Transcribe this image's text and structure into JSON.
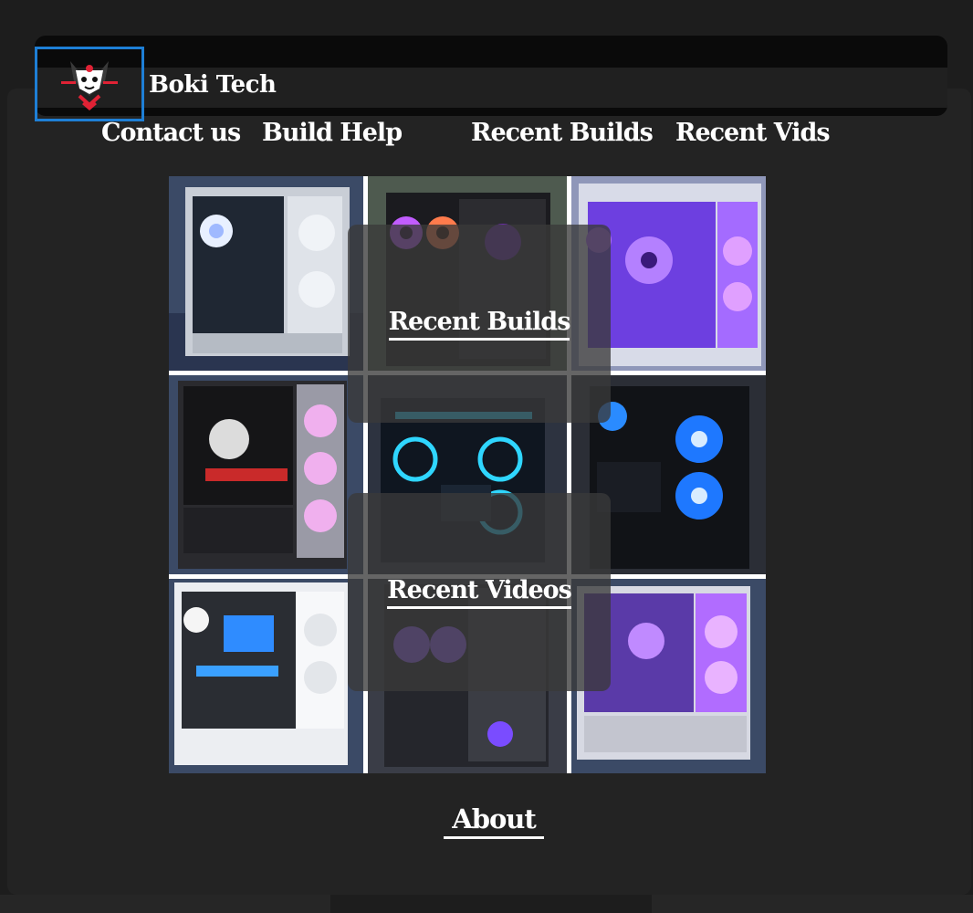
{
  "brand": {
    "title": "Boki Tech",
    "logo_icon": "samurai-cat-logo",
    "accent": "#1e7fd6"
  },
  "nav": {
    "contact": "Contact us",
    "build_help": "Build Help",
    "recent_builds": "Recent Builds",
    "recent_vids": "Recent Vids"
  },
  "gallery": {
    "tiles": [
      {
        "name": "white-fractal-build",
        "glow": "#cfe0ff"
      },
      {
        "name": "dark-mesh-rgb-build",
        "glow": "#c15cff"
      },
      {
        "name": "purple-fan-build",
        "glow": "#9a4cff"
      },
      {
        "name": "montech-pink-build",
        "glow": "#ff9ee8"
      },
      {
        "name": "cyan-ring-build",
        "glow": "#2fd6ff"
      },
      {
        "name": "blue-fan-build",
        "glow": "#2a8bff"
      },
      {
        "name": "white-blue-build",
        "glow": "#3aa0ff"
      },
      {
        "name": "mesh-purple-build",
        "glow": "#9b63ff"
      },
      {
        "name": "white-purple-build",
        "glow": "#b16cff"
      }
    ]
  },
  "overlays": {
    "recent_builds": "Recent Builds",
    "recent_videos": "Recent Videos"
  },
  "footer": {
    "about": "About"
  }
}
